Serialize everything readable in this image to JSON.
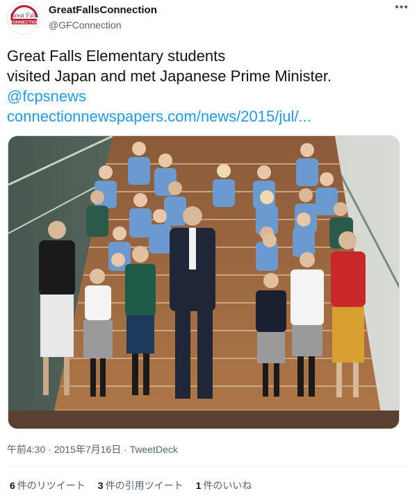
{
  "account": {
    "display_name": "GreatFallsConnection",
    "handle": "@GFConnection",
    "avatar_logo_text": "Great Falls CONNECTION"
  },
  "tweet": {
    "text_line1": "Great Falls Elementary students",
    "text_line2": "visited Japan and met Japanese Prime Minister.",
    "mention": "@fcpsnews",
    "link": "connectionnewspapers.com/news/2015/jul/...",
    "photo_description_icon": "photo",
    "timestamp": "午前4:30 · 2015年7月16日 · TweetDeck"
  },
  "stats": {
    "retweets_count": "6",
    "retweets_label": "件のリツイート",
    "quotes_count": "3",
    "quotes_label": "件の引用ツイート",
    "likes_count": "1",
    "likes_label": "件のいいね"
  },
  "menu_icon": "more-icon",
  "colors": {
    "link": "#1d9bf0",
    "secondary_text": "#536471",
    "divider": "#eff3f4"
  }
}
